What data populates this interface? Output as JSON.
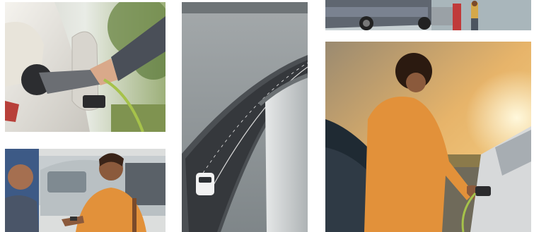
{
  "gallery": {
    "tiles": [
      {
        "id": "ev-charging-closeup"
      },
      {
        "id": "customer-smiling"
      },
      {
        "id": "dam-road-aerial"
      },
      {
        "id": "truck-by-lake"
      },
      {
        "id": "sunset-charging"
      }
    ]
  },
  "colors": {
    "sunset_sky": "#f2b766",
    "water_gray": "#8c9396",
    "road_dark": "#3a3d41",
    "shirt_orange": "#e2913a",
    "foliage_green": "#5f7a3e"
  }
}
